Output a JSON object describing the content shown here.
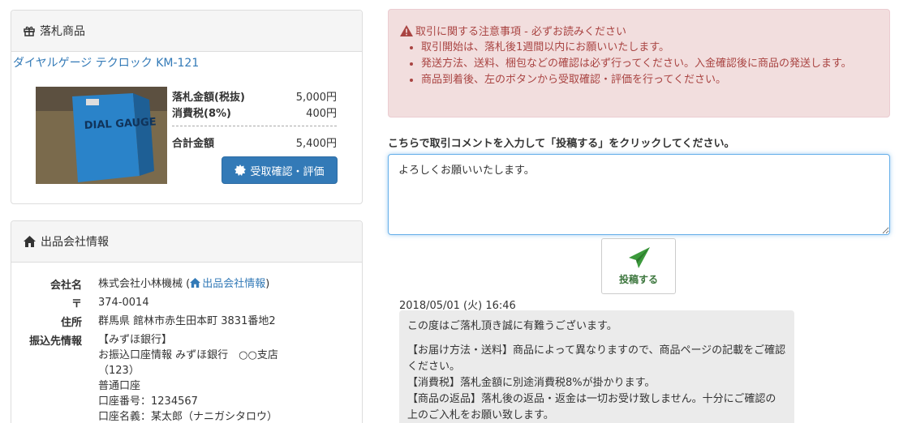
{
  "item_panel": {
    "title": "落札商品",
    "item_name": "ダイヤルゲージ テクロック KM-121",
    "photo_text": "DIAL GAUGE",
    "price_rows": [
      {
        "label": "落札金額(税抜)",
        "value": "5,000円"
      },
      {
        "label": "消費税(8%)",
        "value": "400円"
      },
      {
        "label": "合計金額",
        "value": "5,400円"
      }
    ],
    "receipt_button": "受取確認・評価"
  },
  "company_panel": {
    "title": "出品会社情報",
    "rows": [
      {
        "label": "会社名",
        "value": "株式会社小林機械 (",
        "link": "出品会社情報",
        "suffix": ")"
      },
      {
        "label": "〒",
        "value": "374-0014"
      },
      {
        "label": "住所",
        "value": "群馬県 館林市赤生田本町 3831番地2"
      },
      {
        "label": "振込先情報",
        "lines": [
          "【みずほ銀行】",
          "お振込口座情報 みずほ銀行　○○支店",
          "（123）",
          "普通口座",
          "口座番号：1234567",
          "口座名義：某太郎（ナニガシタロウ）"
        ]
      }
    ]
  },
  "notice": {
    "title": "取引に関する注意事項 - 必ずお読みください",
    "items": [
      "取引開始は、落札後1週間以内にお願いいたします。",
      "発送方法、送料、梱包などの確認は必ず行ってください。入金確認後に商品の発送します。",
      "商品到着後、左のボタンから受取確認・評価を行ってください。"
    ]
  },
  "comment": {
    "instruction": "こちらで取引コメントを入力して「投稿する」をクリックしてください。",
    "value": "よろしくお願いいたします。",
    "post_button": "投稿する"
  },
  "message": {
    "timestamp": "2018/05/01 (火) 16:46",
    "lines": [
      "この度はご落札頂き誠に有難うございます。",
      "",
      "【お届け方法・送料】商品によって異なりますので、商品ページの記載をご確認ください。",
      "【消費税】落札金額に別途消費税8%が掛かります。",
      "【商品の返品】落札後の返品・返金は一切お受け致しません。十分にご確認の上のご入札をお願い致します。"
    ]
  },
  "colors": {
    "link": "#337ab7",
    "primary_button": "#337ab7",
    "alert_bg": "#f2dede",
    "alert_text": "#a94442",
    "post_icon": "#3c9a3c"
  }
}
